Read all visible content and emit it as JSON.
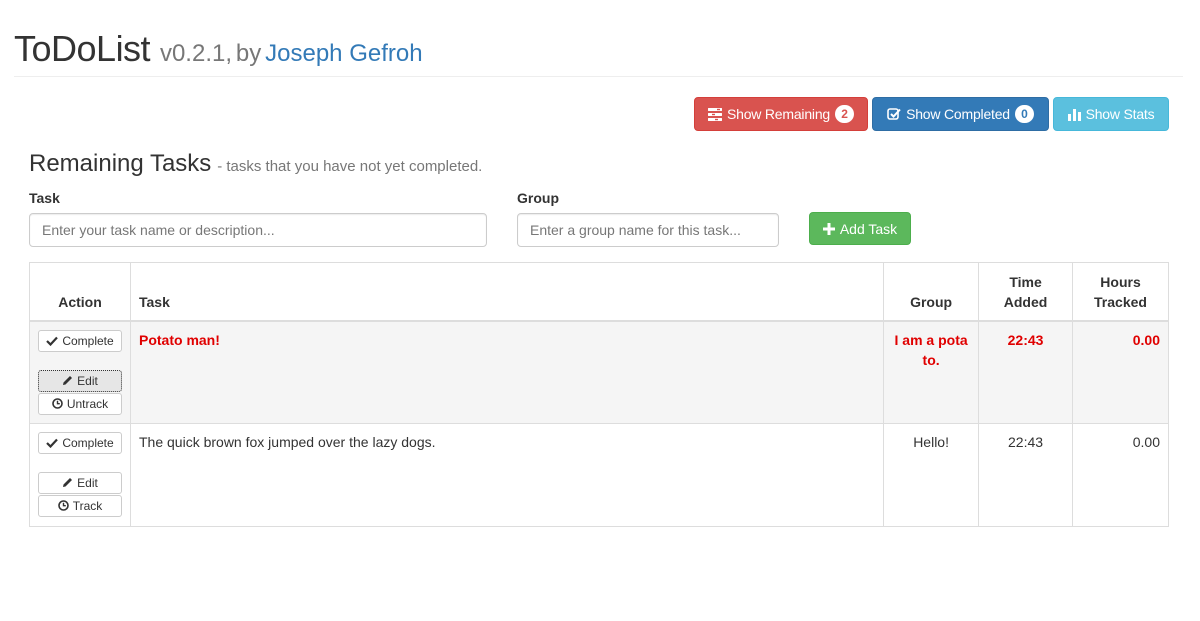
{
  "header": {
    "title": "ToDoList",
    "version": "v0.2.1,",
    "by": "by",
    "author": "Joseph Gefroh"
  },
  "toolbar": {
    "remaining_label": "Show Remaining",
    "remaining_count": "2",
    "completed_label": "Show Completed",
    "completed_count": "0",
    "stats_label": "Show Stats"
  },
  "section": {
    "title": "Remaining Tasks",
    "subtitle": "- tasks that you have not yet completed."
  },
  "form": {
    "task_label": "Task",
    "task_placeholder": "Enter your task name or description...",
    "group_label": "Group",
    "group_placeholder": "Enter a group name for this task...",
    "add_label": "Add Task"
  },
  "table": {
    "headers": {
      "action": "Action",
      "task": "Task",
      "group": "Group",
      "time_added_1": "Time",
      "time_added_2": "Added",
      "hours_tracked_1": "Hours",
      "hours_tracked_2": "Tracked"
    },
    "rows": [
      {
        "task": "Potato man!",
        "group_1": "I am a pota",
        "group_2": "to.",
        "time_added": "22:43",
        "hours_tracked": "0.00",
        "complete_label": "Complete",
        "edit_label": "Edit",
        "track_label": "Untrack",
        "tracking": true
      },
      {
        "task": "The quick brown fox jumped over the lazy dogs.",
        "group_1": "Hello!",
        "group_2": "",
        "time_added": "22:43",
        "hours_tracked": "0.00",
        "complete_label": "Complete",
        "edit_label": "Edit",
        "track_label": "Track",
        "tracking": false
      }
    ]
  },
  "colors": {
    "danger": "#d9534f",
    "primary": "#337ab7",
    "info": "#5bc0de",
    "success": "#5cb85c",
    "tracking_text": "#e00000"
  },
  "icons": {
    "remaining": "tasks-icon",
    "completed": "check-square-icon",
    "stats": "bar-chart-icon",
    "add": "plus-icon",
    "complete": "checkmark-icon",
    "edit": "pencil-icon",
    "track": "clock-icon"
  }
}
